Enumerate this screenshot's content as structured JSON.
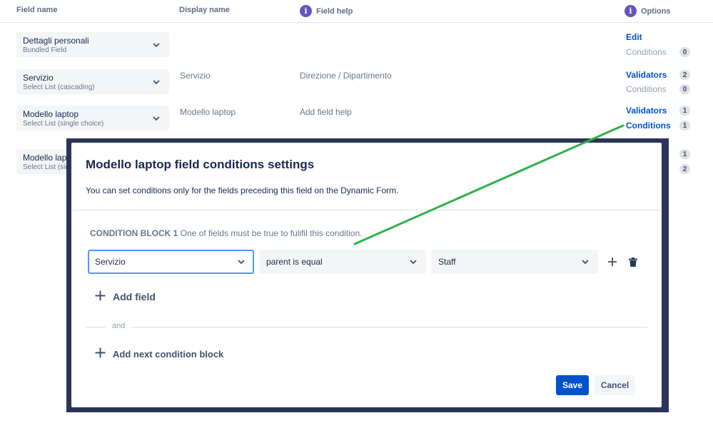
{
  "table": {
    "headers": {
      "field_name": "Field name",
      "display_name": "Display name",
      "field_help": "Field help",
      "options": "Options"
    },
    "info_glyph": "i",
    "rows": [
      {
        "field_name": "Dettagli personali",
        "field_type": "Bundled Field",
        "display_name": "",
        "field_help": "",
        "option1_label": "Edit",
        "option1_count": "",
        "option2_label": "Conditions",
        "option2_count": "0"
      },
      {
        "field_name": "Servizio",
        "field_type": "Select List (cascading)",
        "display_name": "Servizio",
        "field_help": "Direzione / Dipartimento",
        "option1_label": "Validators",
        "option1_count": "2",
        "option2_label": "Conditions",
        "option2_count": "0"
      },
      {
        "field_name": "Modello laptop",
        "field_type": "Select List (single choice)",
        "display_name": "Modello laptop",
        "field_help": "Add field help",
        "option1_label": "Validators",
        "option1_count": "1",
        "option2_label": "Conditions",
        "option2_count": "1"
      },
      {
        "field_name": "Modello lap",
        "field_type": "Select List (sin",
        "option1_count": "1",
        "option2_count": "2"
      }
    ]
  },
  "modal": {
    "title": "Modello laptop field conditions settings",
    "description": "You can set conditions only for the fields preceding this field on the Dynamic Form.",
    "condition_block": {
      "label": "CONDITION BLOCK 1",
      "hint": " One of fields must be true to fulifil this condition.",
      "field_select": "Servizio",
      "operator_select": "parent is equal",
      "value_select": "Staff"
    },
    "add_field_label": "Add field",
    "and_label": "and",
    "add_block_label": "Add next condition block",
    "save_label": "Save",
    "cancel_label": "Cancel"
  },
  "colors": {
    "accent": "#0052cc",
    "info_icon": "#6554c0",
    "overlay": "#2a3557",
    "annotation_arrow": "#2eb24a"
  },
  "icons": {
    "info": "info-icon",
    "chevron": "chevron-down-icon",
    "plus": "plus-icon",
    "trash": "trash-icon"
  }
}
